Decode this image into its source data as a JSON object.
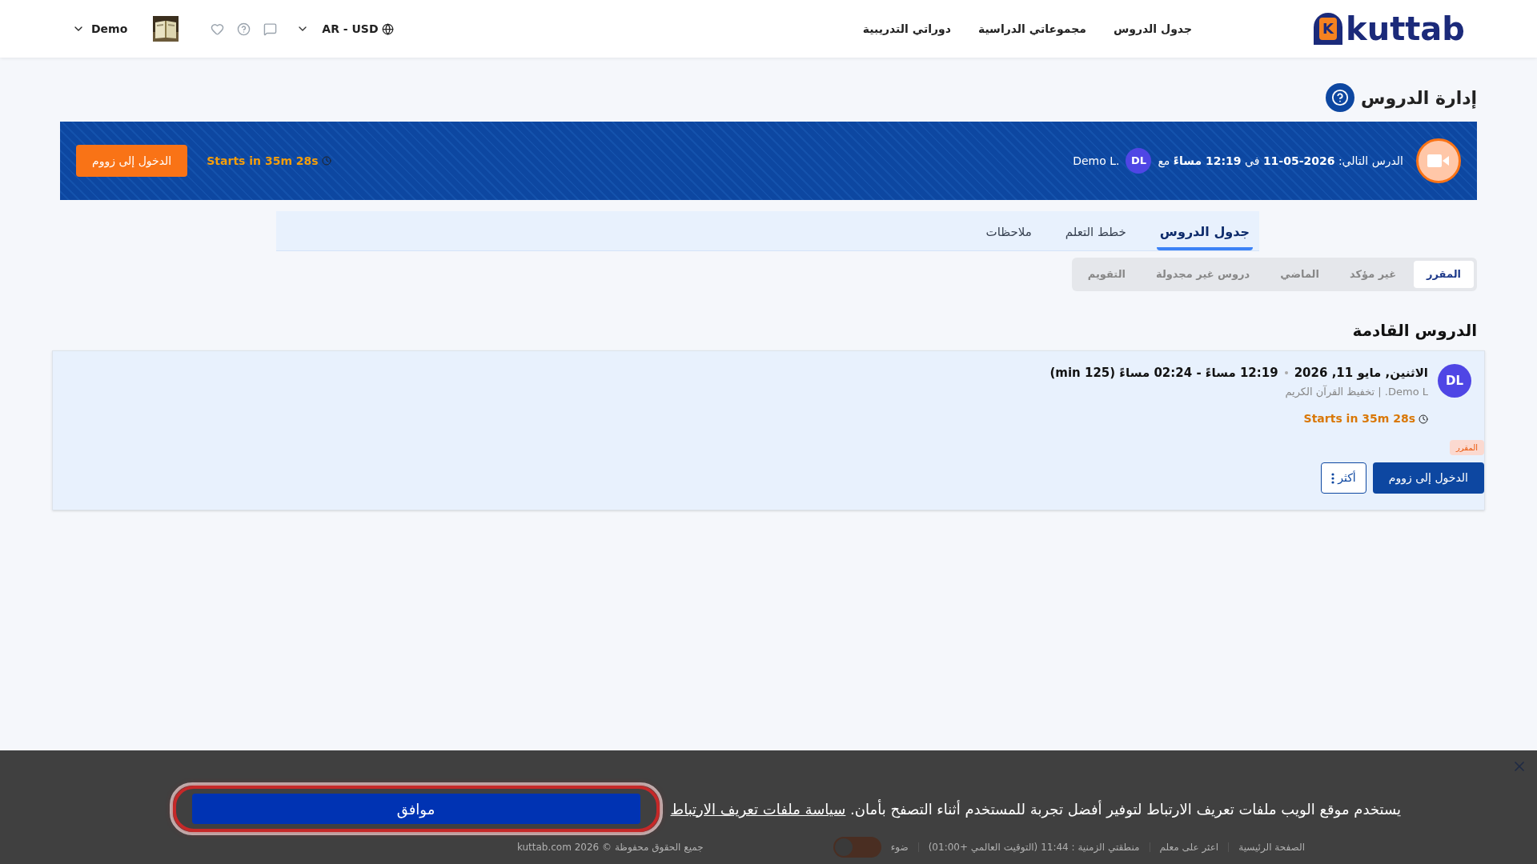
{
  "header": {
    "logo_mark": "K",
    "logo": "kuttab",
    "nav": [
      {
        "label": "جدول الدروس"
      },
      {
        "label": "مجموعاتي الدراسية"
      },
      {
        "label": "دوراتي التدريبية"
      }
    ],
    "language": "AR - USD",
    "user": "Demo"
  },
  "page_title": "إدارة الدروس",
  "next_lesson": {
    "text": "الدرس التالي: **11-05-2026** في **12:19 مساءً** مع",
    "initials": "DL",
    "teacher": "Demo L.",
    "countdown": "Starts in 35m 28s",
    "button": "الدخول إلى زووم"
  },
  "tabs": [
    {
      "label": "جدول الدروس",
      "selected": true
    },
    {
      "label": "خطط التعلم",
      "selected": false
    },
    {
      "label": "ملاحظات",
      "selected": false
    }
  ],
  "subtabs": [
    {
      "label": "المقرر",
      "selected": true
    },
    {
      "label": "غير مؤكد",
      "selected": false
    },
    {
      "label": "الماضي",
      "selected": false
    },
    {
      "label": "دروس غير مجدولة",
      "selected": false
    },
    {
      "label": "التقويم",
      "selected": false
    }
  ],
  "section_title": "الدروس القادمة",
  "lessons": [
    {
      "initials": "DL",
      "date": "الاثنين, مايو 11, 2026",
      "time": "12:19 مساءً - 02:24 مساءً (min 125)",
      "subtitle": "Demo L. | تخفيظ القرآن الكريم",
      "countdown": "Starts in 35m 28s",
      "status": "المقرر",
      "primary": "الدخول إلى زووم",
      "more": "أكثر"
    }
  ],
  "cookie": {
    "text": "يستخدم موقع الويب ملفات تعريف الارتباط لتوفير أفضل تجربة للمستخدم أثناء التصفح بأمان.",
    "link": "سياسة ملفات تعريف الارتباط",
    "button": "موافق"
  },
  "footer": {
    "links": [
      {
        "label": "الصفحة الرئيسية"
      },
      {
        "label": "اعثر على معلم"
      }
    ],
    "timezone": "منطقتي الزمنية : 11:44 (التوقيت العالمي +01:00)",
    "theme": {
      "label": "ضوء",
      "on": false
    },
    "copyright": "جميع الحقوق محفوظة © kuttab.com 2026"
  }
}
